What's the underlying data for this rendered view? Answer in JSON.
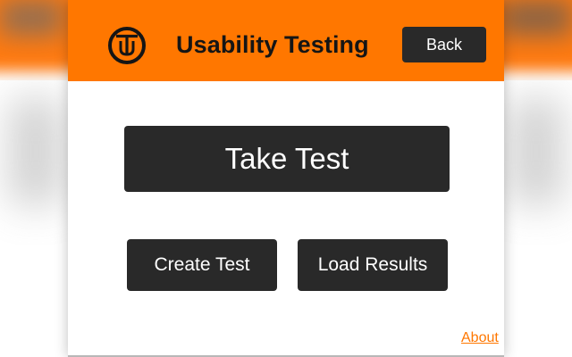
{
  "app": {
    "title": "Usability Testing",
    "logo_icon": "ut-logo-icon"
  },
  "header": {
    "back_label": "Back"
  },
  "main": {
    "take_test_label": "Take Test",
    "create_test_label": "Create Test",
    "load_results_label": "Load Results"
  },
  "footer": {
    "about_label": "About"
  },
  "colors": {
    "accent": "#ff7700",
    "button_bg": "#292929",
    "button_text": "#ffffff",
    "title_text": "#151515",
    "panel_bg": "#ffffff"
  }
}
